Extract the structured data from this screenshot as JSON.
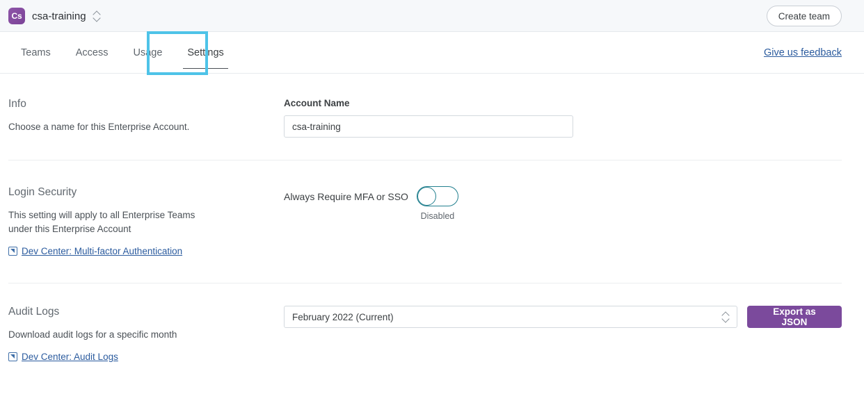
{
  "topbar": {
    "logo_initials": "Cs",
    "org_name": "csa-training",
    "org_switcher_icon": "chevron-up-down-icon",
    "create_team_label": "Create team"
  },
  "tabs": {
    "items": [
      {
        "label": "Teams",
        "active": false
      },
      {
        "label": "Access",
        "active": false
      },
      {
        "label": "Usage",
        "active": false
      },
      {
        "label": "Settings",
        "active": true
      }
    ],
    "feedback_label": "Give us feedback",
    "highlight_color": "#4ec3e8"
  },
  "sections": {
    "info": {
      "title": "Info",
      "description": "Choose a name for this Enterprise Account.",
      "field_label": "Account Name",
      "field_value": "csa-training",
      "field_placeholder": "Account Name"
    },
    "login_security": {
      "title": "Login Security",
      "description": "This setting will apply to all Enterprise Teams under this Enterprise Account",
      "doc_link": "Dev Center: Multi-factor Authentication",
      "doc_link_icon": "external-link-icon",
      "toggle_label": "Always Require MFA or SSO",
      "toggle_state": "Disabled",
      "toggle_on": false,
      "toggle_color": "#23808f"
    },
    "audit_logs": {
      "title": "Audit Logs",
      "description": "Download audit logs for a specific month",
      "doc_link": "Dev Center: Audit Logs",
      "doc_link_icon": "external-link-icon",
      "month_selected": "February 2022 (Current)",
      "month_options": [
        "February 2022 (Current)"
      ],
      "export_label": "Export as JSON",
      "export_color": "#7b4a9c"
    }
  }
}
